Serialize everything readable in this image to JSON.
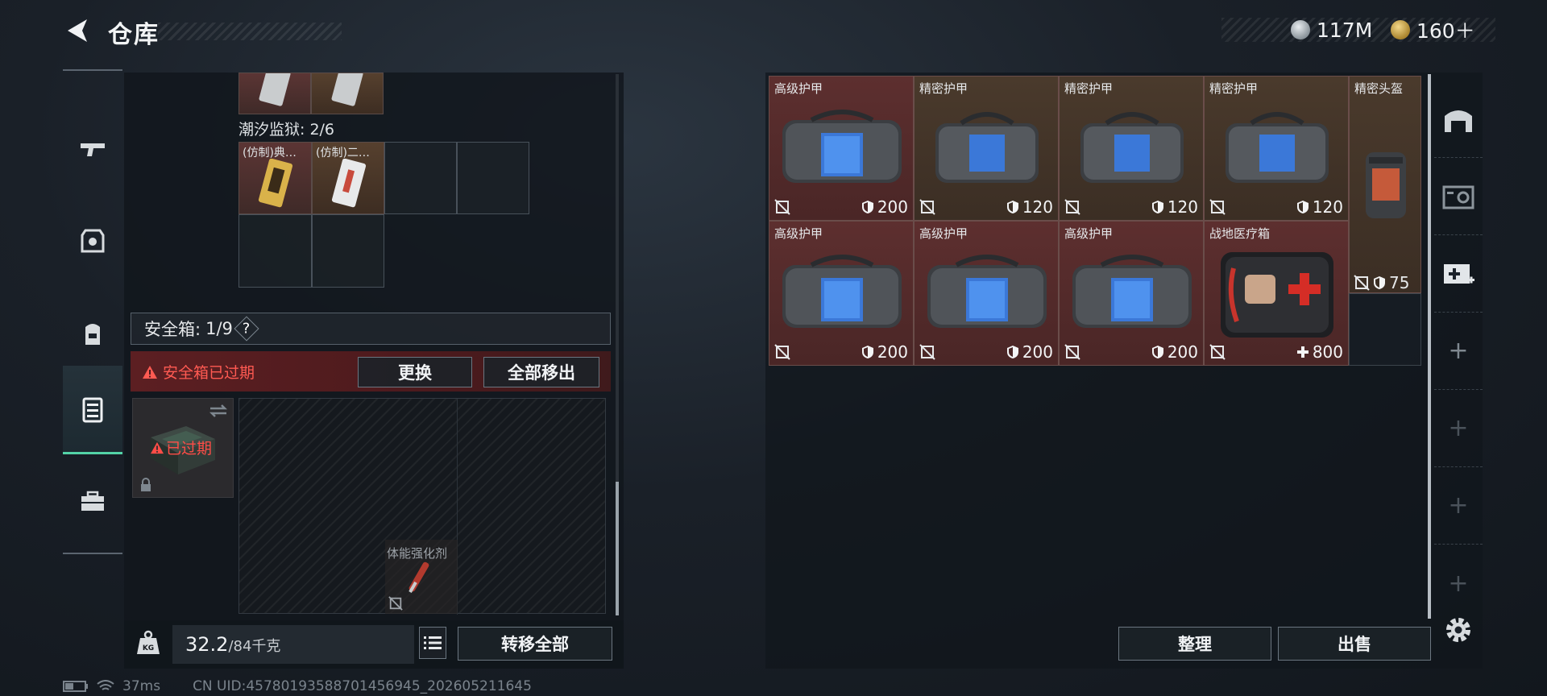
{
  "header": {
    "title": "仓库"
  },
  "currency": {
    "silver": "117M",
    "gold": "160＋"
  },
  "left": {
    "collection_label": "潮汐监狱: 2/6",
    "items": [
      {
        "name": "(仿制)典…"
      },
      {
        "name": "(仿制)二…"
      }
    ],
    "safebox": {
      "label": "安全箱:",
      "count": "1/9",
      "help": "?"
    },
    "warning": "安全箱已过期",
    "replace_label": "更换",
    "move_all_out_label": "全部移出",
    "expired_label": "已过期",
    "safe_item_name": "体能强化剂",
    "weight": {
      "current": "32.2",
      "max": "/84千克"
    },
    "transfer_all_label": "转移全部"
  },
  "right": {
    "items": [
      {
        "name": "高级护甲",
        "value": "200"
      },
      {
        "name": "精密护甲",
        "value": "120"
      },
      {
        "name": "精密护甲",
        "value": "120"
      },
      {
        "name": "精密护甲",
        "value": "120"
      },
      {
        "name": "精密头盔",
        "value": "75"
      },
      {
        "name": "高级护甲",
        "value": "200"
      },
      {
        "name": "高级护甲",
        "value": "200"
      },
      {
        "name": "高级护甲",
        "value": "200"
      },
      {
        "name": "战地医疗箱",
        "value": "800"
      }
    ],
    "sort_label": "整理",
    "sell_label": "出售"
  },
  "status": {
    "ping": "37ms",
    "uid": "CN UID:457801935887014569​45_202605211645"
  }
}
